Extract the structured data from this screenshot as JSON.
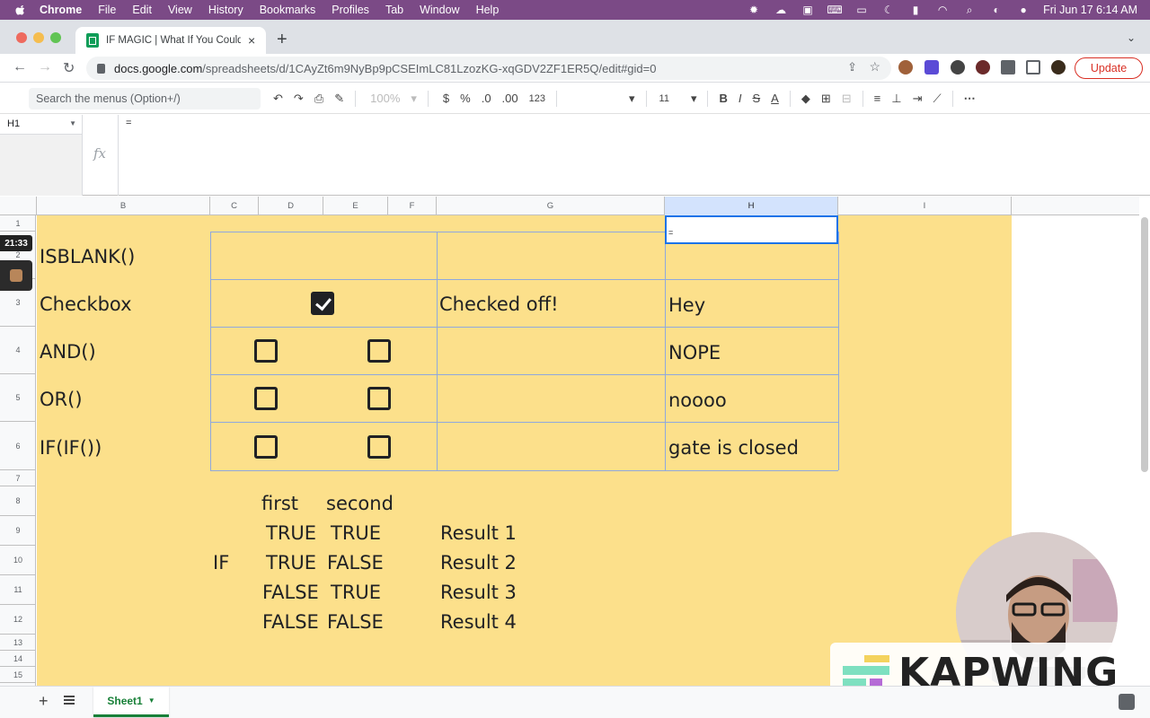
{
  "mac_menubar": {
    "app": "Chrome",
    "items": [
      "File",
      "Edit",
      "View",
      "History",
      "Bookmarks",
      "Profiles",
      "Tab",
      "Window",
      "Help"
    ],
    "clock": "Fri Jun 17  6:14 AM",
    "status_icons": [
      "gear-icon",
      "cloud-icon",
      "scan-icon",
      "keyboard-icon",
      "screen-icon",
      "moon-icon",
      "battery-icon",
      "wifi-icon",
      "search-icon",
      "control-center-icon",
      "siri-icon"
    ]
  },
  "browser": {
    "tab_title": "IF MAGIC | What If You Could F",
    "url_host": "docs.google.com",
    "url_path": "/spreadsheets/d/1CAyZt6m9NyBp9pCSEImLC81LzozKG-xqGDV2ZF1ER5Q/edit#gid=0",
    "update_label": "Update",
    "new_tab_symbol": "+",
    "close_symbol": "×"
  },
  "toolbar": {
    "menu_search_placeholder": "Search the menus (Option+/)",
    "zoom": "100%",
    "currency": "$",
    "percent": "%",
    "dec_decrease": ".0",
    "dec_increase": ".00",
    "format_more": "123",
    "font_size": "11",
    "bold": "B",
    "italic": "I",
    "strike": "S",
    "text_color": "A",
    "more": "⋯"
  },
  "formula_bar": {
    "name_box": "H1",
    "fx_label": "fx",
    "content": "="
  },
  "grid": {
    "columns": [
      "B",
      "C",
      "D",
      "E",
      "F",
      "G",
      "H",
      "I"
    ],
    "selected_column": "H",
    "rows": [
      "1",
      "2",
      "3",
      "4",
      "5",
      "6",
      "7",
      "8",
      "9",
      "10",
      "11",
      "12",
      "13",
      "14",
      "15"
    ],
    "selected_cell_value": "=",
    "row_labels": [
      "ISBLANK()",
      "Checkbox",
      "AND()",
      "OR()",
      "IF(IF())"
    ],
    "checked_text": "Checked off!",
    "results_h": [
      "Hey",
      "NOPE",
      "noooo",
      "gate is closed"
    ],
    "truth_table": {
      "if_label": "IF",
      "headers": [
        "first",
        "second"
      ],
      "rows": [
        [
          "TRUE",
          "TRUE",
          "Result 1"
        ],
        [
          "TRUE",
          "FALSE",
          "Result 2"
        ],
        [
          "FALSE",
          "TRUE",
          "Result 3"
        ],
        [
          "FALSE",
          "FALSE",
          "Result 4"
        ]
      ]
    },
    "checkboxes": {
      "checkbox_row": [
        true
      ],
      "and_row": [
        false,
        false
      ],
      "or_row": [
        false,
        false
      ],
      "ifif_row": [
        false,
        false
      ]
    }
  },
  "sheet_tabs": {
    "add_symbol": "+",
    "active": "Sheet1"
  },
  "overlay": {
    "timer": "21:33",
    "watermark": "KAPWING"
  },
  "colors": {
    "menubar": "#7b4a86",
    "sheet_fill": "#fce08b",
    "selection_blue": "#1a73e8",
    "update_red": "#d93025",
    "sheet_tab_green": "#188038"
  }
}
